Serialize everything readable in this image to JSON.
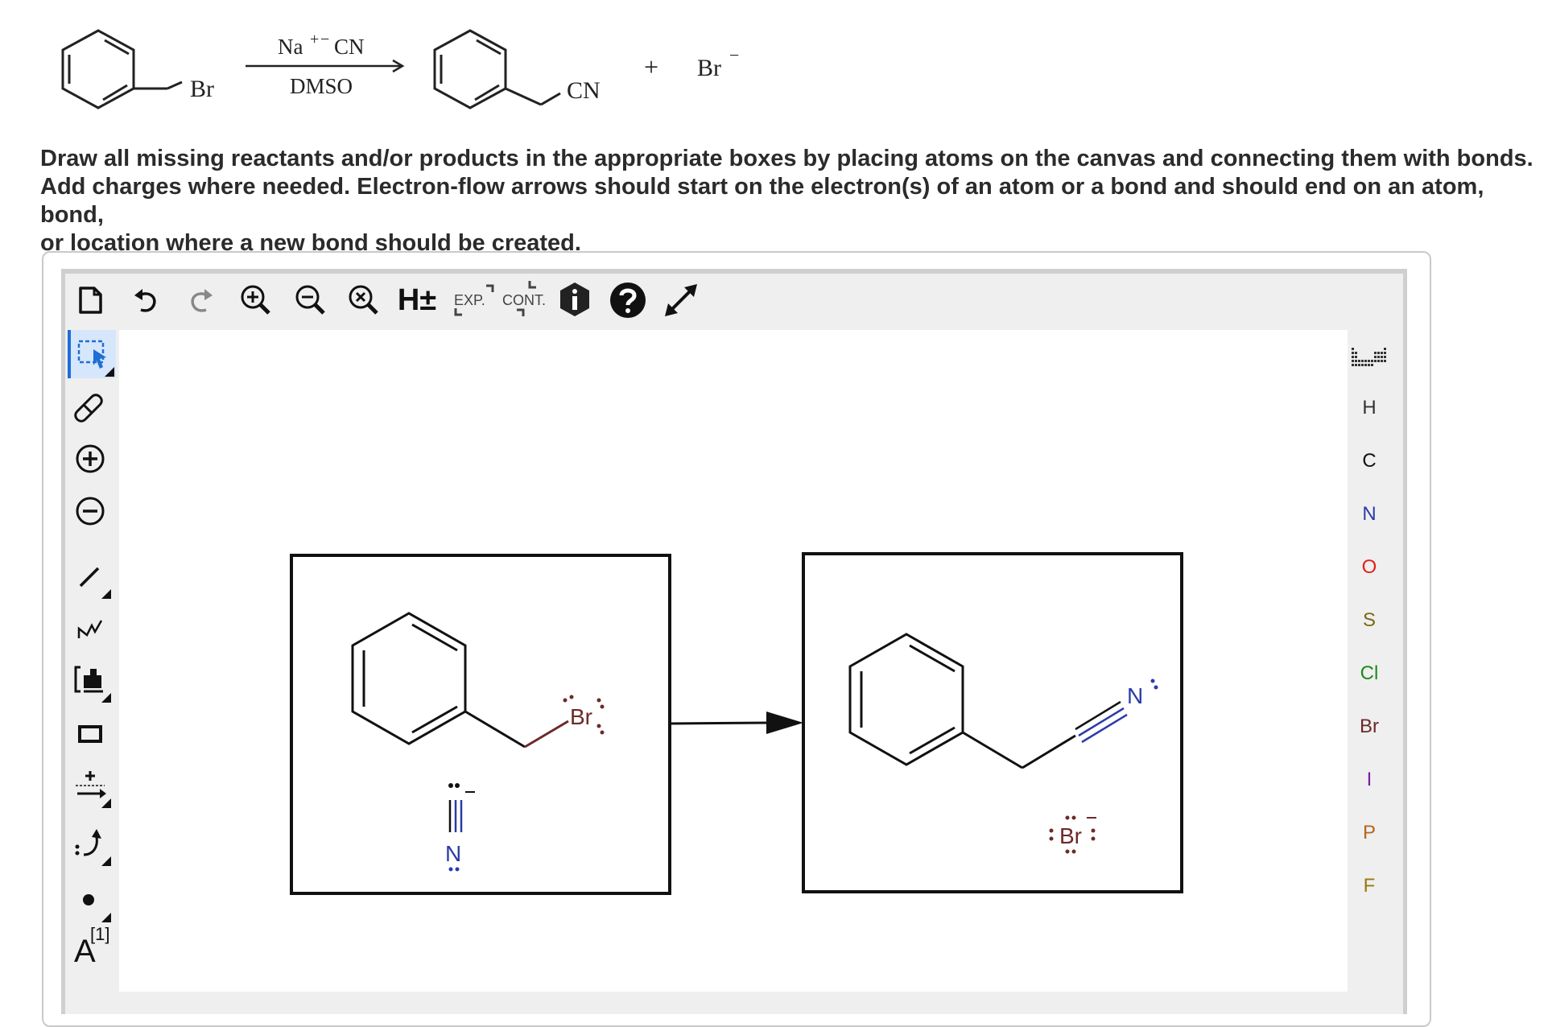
{
  "scheme": {
    "reactant_label": "Br",
    "reagent_top": "Na",
    "reagent_top_plus": "+",
    "reagent_top_minus": "−",
    "reagent_top_cn": "CN",
    "reagent_bottom": "DMSO",
    "product_label": "CN",
    "plus": "+",
    "byproduct": "Br",
    "byproduct_charge": "−"
  },
  "instructions": {
    "line1": "Draw all missing reactants and/or products in the appropriate boxes by placing atoms on the canvas and connecting them with bonds.",
    "line2": "Add charges where needed. Electron-flow arrows should start on the electron(s) of an atom or a bond and should end on an atom, bond,",
    "line3": "or location where a new bond should be created."
  },
  "toolbar": {
    "hydrogen_label": "H±",
    "expand_label": "EXP.",
    "contract_label": "CONT."
  },
  "left_toolbar": {
    "atom_map_label": "A",
    "atom_map_index": "[1]"
  },
  "atoms_panel": {
    "items": [
      {
        "symbol": "H",
        "color": "#333333"
      },
      {
        "symbol": "C",
        "color": "#111111"
      },
      {
        "symbol": "N",
        "color": "#2b3ba8"
      },
      {
        "symbol": "O",
        "color": "#e0201b"
      },
      {
        "symbol": "S",
        "color": "#7b6a12"
      },
      {
        "symbol": "Cl",
        "color": "#1b8a1b"
      },
      {
        "symbol": "Br",
        "color": "#6b2a28"
      },
      {
        "symbol": "I",
        "color": "#7a1fa0"
      },
      {
        "symbol": "P",
        "color": "#b5651d"
      },
      {
        "symbol": "F",
        "color": "#9a7a12"
      }
    ]
  },
  "canvas": {
    "left_box": {
      "bromine_label": "Br",
      "cyanide_n_label": "N",
      "cyanide_charge": "−"
    },
    "right_box": {
      "nitrile_n_label": "N",
      "bromide_label": "Br",
      "bromide_charge": "−"
    }
  },
  "colors": {
    "br_color": "#6b2a28",
    "n_color": "#2b3ba8",
    "active_tool": "#1f6fd6"
  }
}
